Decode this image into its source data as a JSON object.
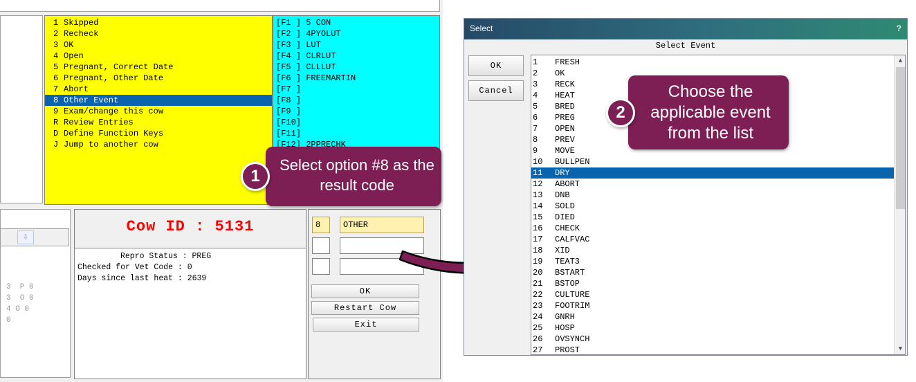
{
  "menu": {
    "items": [
      {
        "key": "1",
        "label": "Skipped"
      },
      {
        "key": "2",
        "label": "Recheck"
      },
      {
        "key": "3",
        "label": "OK"
      },
      {
        "key": "4",
        "label": "Open"
      },
      {
        "key": "5",
        "label": "Pregnant, Correct Date"
      },
      {
        "key": "6",
        "label": "Pregnant, Other Date"
      },
      {
        "key": "7",
        "label": "Abort"
      },
      {
        "key": "8",
        "label": "Other Event"
      },
      {
        "key": "9",
        "label": "Exam/change this cow"
      },
      {
        "key": "R",
        "label": "Review Entries"
      },
      {
        "key": "D",
        "label": "Define Function Keys"
      },
      {
        "key": "J",
        "label": "Jump to another cow"
      }
    ],
    "selected_index": 7
  },
  "function_keys": [
    {
      "key": "[F1 ]",
      "value": "5 CON"
    },
    {
      "key": "[F2 ]",
      "value": "4PYOLUT"
    },
    {
      "key": "[F3 ]",
      "value": "LUT"
    },
    {
      "key": "[F4 ]",
      "value": "CLRLUT"
    },
    {
      "key": "[F5 ]",
      "value": "CLLLUT"
    },
    {
      "key": "[F6 ]",
      "value": "FREEMARTIN"
    },
    {
      "key": "[F7 ]",
      "value": ""
    },
    {
      "key": "[F8 ]",
      "value": ""
    },
    {
      "key": "[F9 ]",
      "value": ""
    },
    {
      "key": "[F10]",
      "value": ""
    },
    {
      "key": "[F11]",
      "value": ""
    },
    {
      "key": "[F12]",
      "value": "2PPRECHK"
    }
  ],
  "mini_list": {
    "rows": [
      "3  P 0",
      "3  O 0",
      "4 O 0",
      "0"
    ]
  },
  "cow": {
    "id_text": "Cow ID : 5131",
    "repro_status": "Repro Status : PREG",
    "vet_code": "Checked for Vet Code : 0",
    "days_since_heat": "Days since last heat : 2639"
  },
  "entry": {
    "code": "8",
    "event": "OTHER",
    "ok_label": "OK",
    "restart_label": "Restart Cow",
    "exit_label": "Exit"
  },
  "callouts": {
    "step1_number": "1",
    "step1_text": "Select option #8 as the result code",
    "step2_number": "2",
    "step2_text": "Choose the applicable event from the list"
  },
  "dialog": {
    "title": "Select",
    "help": "?",
    "heading": "Select Event",
    "ok_label": "OK",
    "cancel_label": "Cancel",
    "events": [
      {
        "n": "1",
        "name": "FRESH"
      },
      {
        "n": "2",
        "name": "OK"
      },
      {
        "n": "3",
        "name": "RECK"
      },
      {
        "n": "4",
        "name": "HEAT"
      },
      {
        "n": "5",
        "name": "BRED"
      },
      {
        "n": "6",
        "name": "PREG"
      },
      {
        "n": "7",
        "name": "OPEN"
      },
      {
        "n": "8",
        "name": "PREV"
      },
      {
        "n": "9",
        "name": "MOVE"
      },
      {
        "n": "10",
        "name": "BULLPEN"
      },
      {
        "n": "11",
        "name": "DRY"
      },
      {
        "n": "12",
        "name": "ABORT"
      },
      {
        "n": "13",
        "name": "DNB"
      },
      {
        "n": "14",
        "name": "SOLD"
      },
      {
        "n": "15",
        "name": "DIED"
      },
      {
        "n": "16",
        "name": "CHECK"
      },
      {
        "n": "17",
        "name": "CALFVAC"
      },
      {
        "n": "18",
        "name": "XID"
      },
      {
        "n": "19",
        "name": "TEAT3"
      },
      {
        "n": "20",
        "name": "BSTART"
      },
      {
        "n": "21",
        "name": "BSTOP"
      },
      {
        "n": "22",
        "name": "CULTURE"
      },
      {
        "n": "23",
        "name": "FOOTRIM"
      },
      {
        "n": "24",
        "name": "GNRH"
      },
      {
        "n": "25",
        "name": "HOSP"
      },
      {
        "n": "26",
        "name": "OVSYNCH"
      },
      {
        "n": "27",
        "name": "PROST"
      }
    ],
    "selected_index": 10
  },
  "colors": {
    "menu_bg": "#ffff00",
    "fkey_bg": "#00ffff",
    "selection": "#0a64ad",
    "callout": "#7d1f55",
    "cow_id": "#ff0000"
  }
}
